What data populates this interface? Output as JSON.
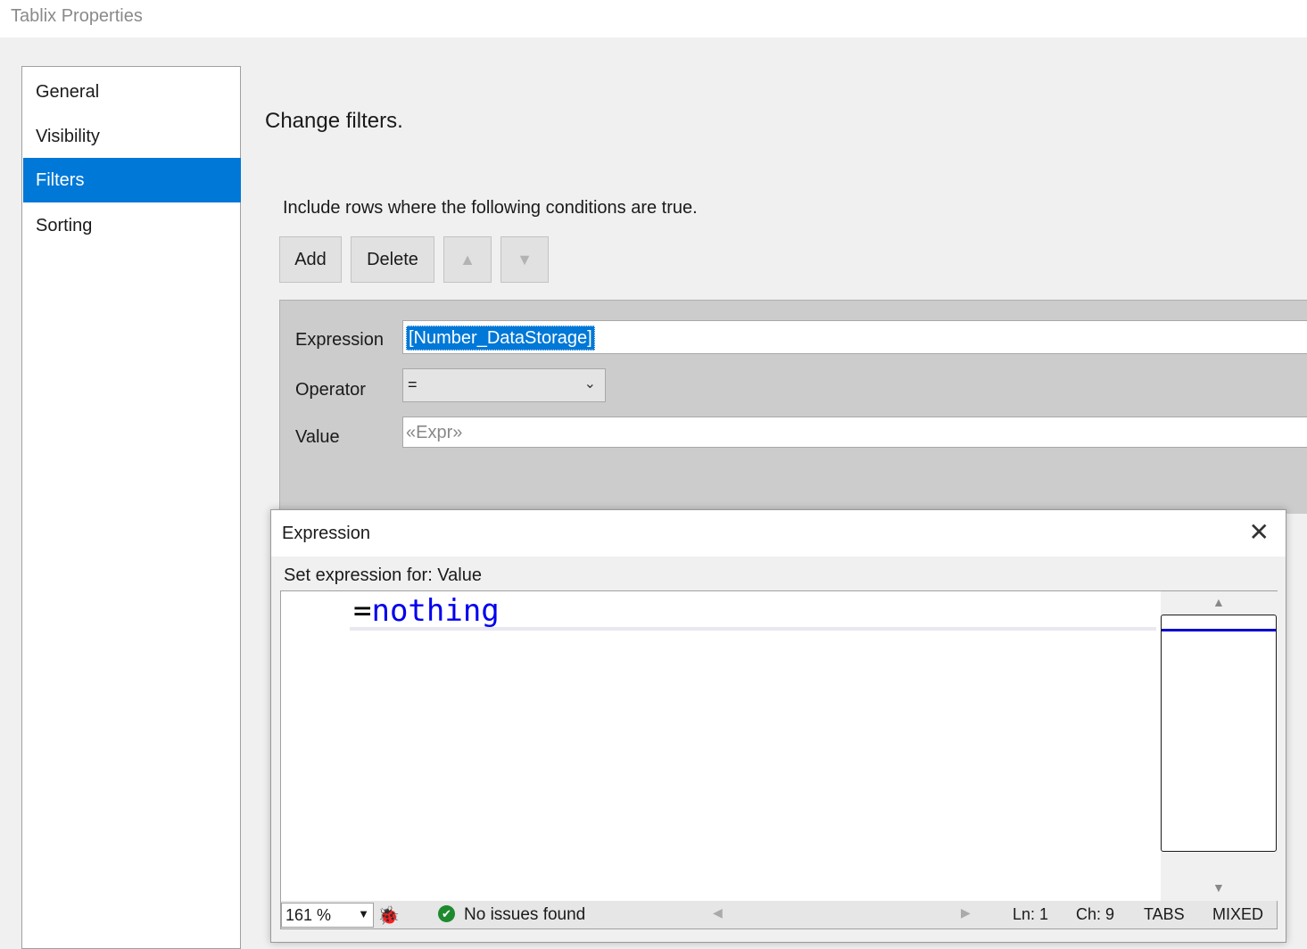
{
  "window": {
    "title": "Tablix Properties"
  },
  "nav": {
    "items": [
      {
        "label": "General",
        "selected": false
      },
      {
        "label": "Visibility",
        "selected": false
      },
      {
        "label": "Filters",
        "selected": true
      },
      {
        "label": "Sorting",
        "selected": false
      }
    ]
  },
  "main": {
    "heading": "Change filters.",
    "instruction": "Include rows where the following conditions are true.",
    "toolbar": {
      "add_label": "Add",
      "delete_label": "Delete",
      "move_up_icon": "arrow-up-icon",
      "move_down_icon": "arrow-down-icon"
    },
    "filter": {
      "expression_label": "Expression",
      "expression_value": "[Number_DataStorage]",
      "operator_label": "Operator",
      "operator_value": "=",
      "value_label": "Value",
      "value_placeholder": "«Expr»"
    }
  },
  "dialog": {
    "title": "Expression",
    "close_icon": "close-icon",
    "subtitle": "Set expression for: Value",
    "code": {
      "operator": "=",
      "keyword": "nothing"
    },
    "status": {
      "zoom": "161 %",
      "issues": "No issues found",
      "line": "Ln: 1",
      "char": "Ch: 9",
      "tabs": "TABS",
      "eol": "MIXED"
    }
  },
  "colors": {
    "accent": "#0078d7",
    "keyword": "#0000ee",
    "ok": "#1e8a2e"
  }
}
